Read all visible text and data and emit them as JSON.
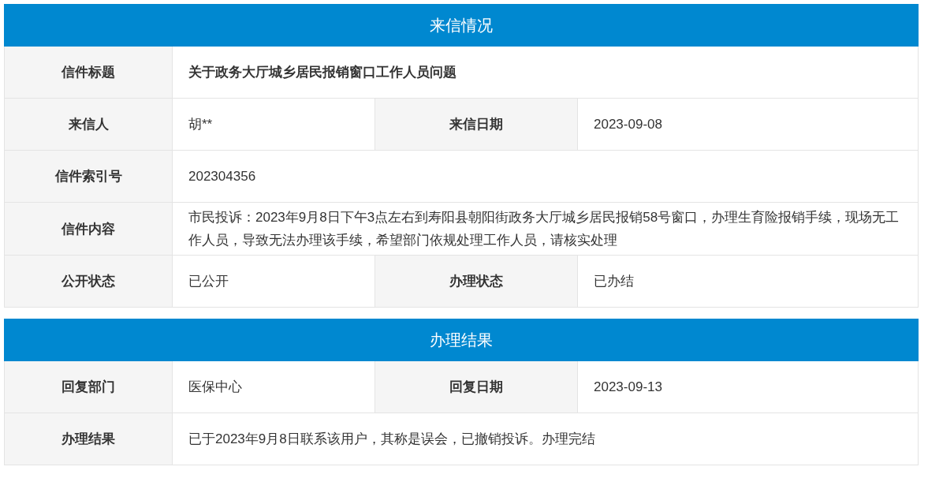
{
  "sections": [
    {
      "title": "来信情况",
      "rows": [
        [
          {
            "label": "信件标题",
            "value": "关于政务大厅城乡居民报销窗口工作人员问题",
            "bold": true
          }
        ],
        [
          {
            "label": "来信人",
            "value": "胡**",
            "bold": false
          },
          {
            "label": "来信日期",
            "value": "2023-09-08",
            "bold": false
          }
        ],
        [
          {
            "label": "信件索引号",
            "value": "202304356",
            "bold": false
          }
        ],
        [
          {
            "label": "信件内容",
            "value": "市民投诉：2023年9月8日下午3点左右到寿阳县朝阳街政务大厅城乡居民报销58号窗口，办理生育险报销手续，现场无工作人员，导致无法办理该手续，希望部门依规处理工作人员，请核实处理",
            "bold": false
          }
        ],
        [
          {
            "label": "公开状态",
            "value": "已公开",
            "bold": false
          },
          {
            "label": "办理状态",
            "value": "已办结",
            "bold": false
          }
        ]
      ]
    },
    {
      "title": "办理结果",
      "rows": [
        [
          {
            "label": "回复部门",
            "value": "医保中心",
            "bold": false
          },
          {
            "label": "回复日期",
            "value": "2023-09-13",
            "bold": false
          }
        ],
        [
          {
            "label": "办理结果",
            "value": "已于2023年9月8日联系该用户，其称是误会，已撤销投诉。办理完结",
            "bold": false
          }
        ]
      ]
    }
  ]
}
